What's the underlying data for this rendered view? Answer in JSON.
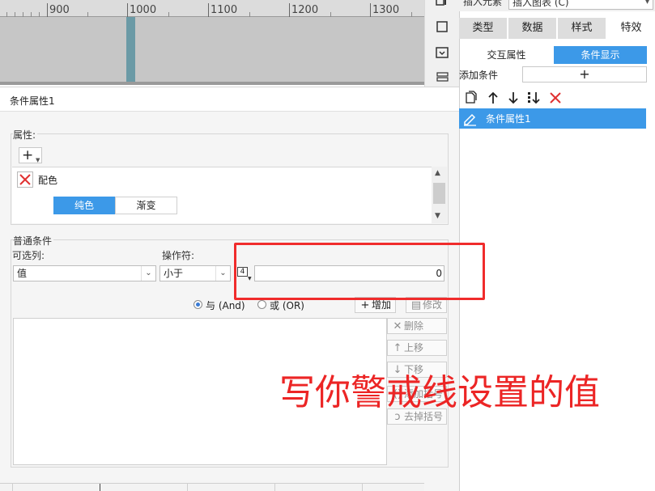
{
  "ruler": {
    "labels": [
      "900",
      "1000",
      "1100",
      "1200",
      "1300"
    ]
  },
  "right_panel": {
    "insert_element_label": "插入元素",
    "insert_chart_value": "插入图表 (C)",
    "tabs": [
      {
        "label": "类型",
        "active": false
      },
      {
        "label": "数据",
        "active": false
      },
      {
        "label": "样式",
        "active": false
      },
      {
        "label": "特效",
        "active": true
      }
    ],
    "sub_tabs": [
      {
        "label": "交互属性",
        "active": false
      },
      {
        "label": "条件显示",
        "active": true
      }
    ],
    "add_condition_label": "添加条件",
    "add_condition_button": "+",
    "condition_items": [
      {
        "label": "条件属性1",
        "selected": true
      }
    ]
  },
  "dialog": {
    "title": "条件属性1",
    "property_group_label": "属性:",
    "add_property_button": "+",
    "property_name": "配色",
    "color_modes": [
      {
        "label": "纯色",
        "active": true
      },
      {
        "label": "渐变",
        "active": false
      }
    ],
    "normal_condition_label": "普通条件",
    "optional_column_label": "可选列:",
    "operator_label": "操作符:",
    "column_value": "值",
    "operator_value": "小于",
    "value_type_glyph": "4",
    "value_input": "0",
    "radio_and": "与 (And)",
    "radio_or": "或 (OR)",
    "radio_selected": "and",
    "buttons": {
      "add": "增加",
      "modify": "修改",
      "delete": "删除",
      "move_up": "上移",
      "move_down": "下移",
      "add_parens": "添加括号",
      "remove_parens": "去掉括号"
    }
  },
  "annotation": {
    "text": "写你警戒线设置的值",
    "color": "#ec2525"
  },
  "colors": {
    "accent": "#3c99e8",
    "highlight_border": "#f02c2c"
  }
}
